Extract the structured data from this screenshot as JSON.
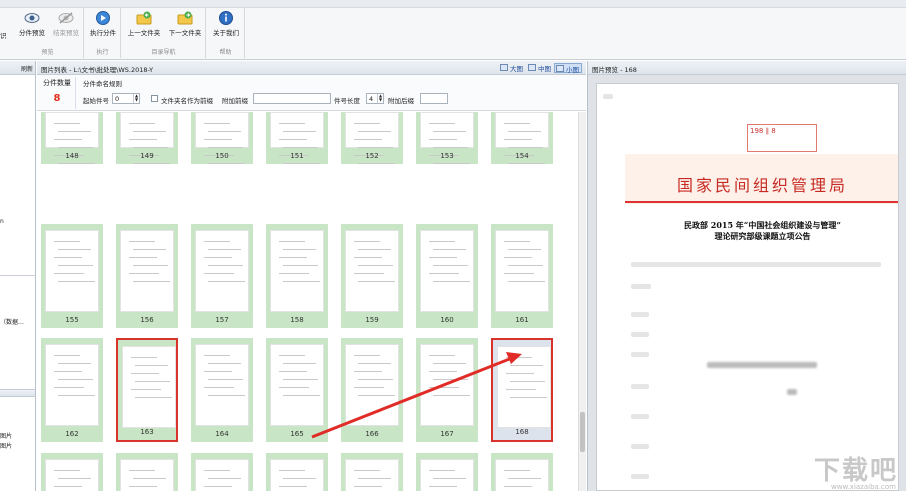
{
  "ribbon": {
    "edge_label": "识",
    "buttons": [
      {
        "label": "分件预览",
        "icon": "eye-icon",
        "enabled": true
      },
      {
        "label": "结束预览",
        "icon": "eye-off-icon",
        "enabled": false
      },
      {
        "label": "执行分件",
        "icon": "play-icon",
        "enabled": true
      },
      {
        "label": "上一文件夹",
        "icon": "folder-prev-icon",
        "enabled": true
      },
      {
        "label": "下一文件夹",
        "icon": "folder-next-icon",
        "enabled": true
      },
      {
        "label": "关于我们",
        "icon": "info-icon",
        "enabled": true
      }
    ],
    "groups": [
      "预览",
      "执行",
      "目录导航",
      "帮助"
    ]
  },
  "left_pane": {
    "header": "刷新",
    "items": [
      "n",
      "（数据…",
      "图片",
      "图片"
    ]
  },
  "center": {
    "title": "图片列表 - L:\\文书\\批处理\\WS.2018-Y",
    "view_buttons": [
      "大图",
      "中图",
      "小图"
    ],
    "active_view": "小图",
    "options": {
      "count_label": "分件数量",
      "count_value": "8",
      "rule_label": "分件命名规则",
      "start_label": "起始件号",
      "start_value": "0",
      "folder_prefix_label": "文件夹名作为前缀",
      "prefix_label": "附加前缀",
      "width_label": "件号长度",
      "width_value": "4",
      "suffix_label": "附加后缀"
    },
    "rows": [
      [
        "148",
        "149",
        "150",
        "151",
        "152",
        "153",
        "154"
      ],
      [
        "155",
        "156",
        "157",
        "158",
        "159",
        "160",
        "161"
      ],
      [
        "162",
        "163",
        "164",
        "165",
        "166",
        "167",
        "168"
      ],
      [
        "",
        "",
        "",
        "",
        "",
        "",
        ""
      ]
    ],
    "selected_pages": [
      "163",
      "168"
    ]
  },
  "preview": {
    "title": "图片预览 - 168",
    "org_name": "国家民间组织管理局",
    "heading_line1": "民政部 2015 年“中国社会组织建设与管理”",
    "heading_line2": "理论研究部级课题立项公告",
    "stamp_text": "198 ∥ 8"
  },
  "watermark": {
    "text": "下载吧",
    "sub": "www.xiazaiba.com"
  },
  "colors": {
    "accent_red": "#d9342b",
    "thumb_green": "#c8e6c5",
    "org_red": "#c62b23"
  }
}
